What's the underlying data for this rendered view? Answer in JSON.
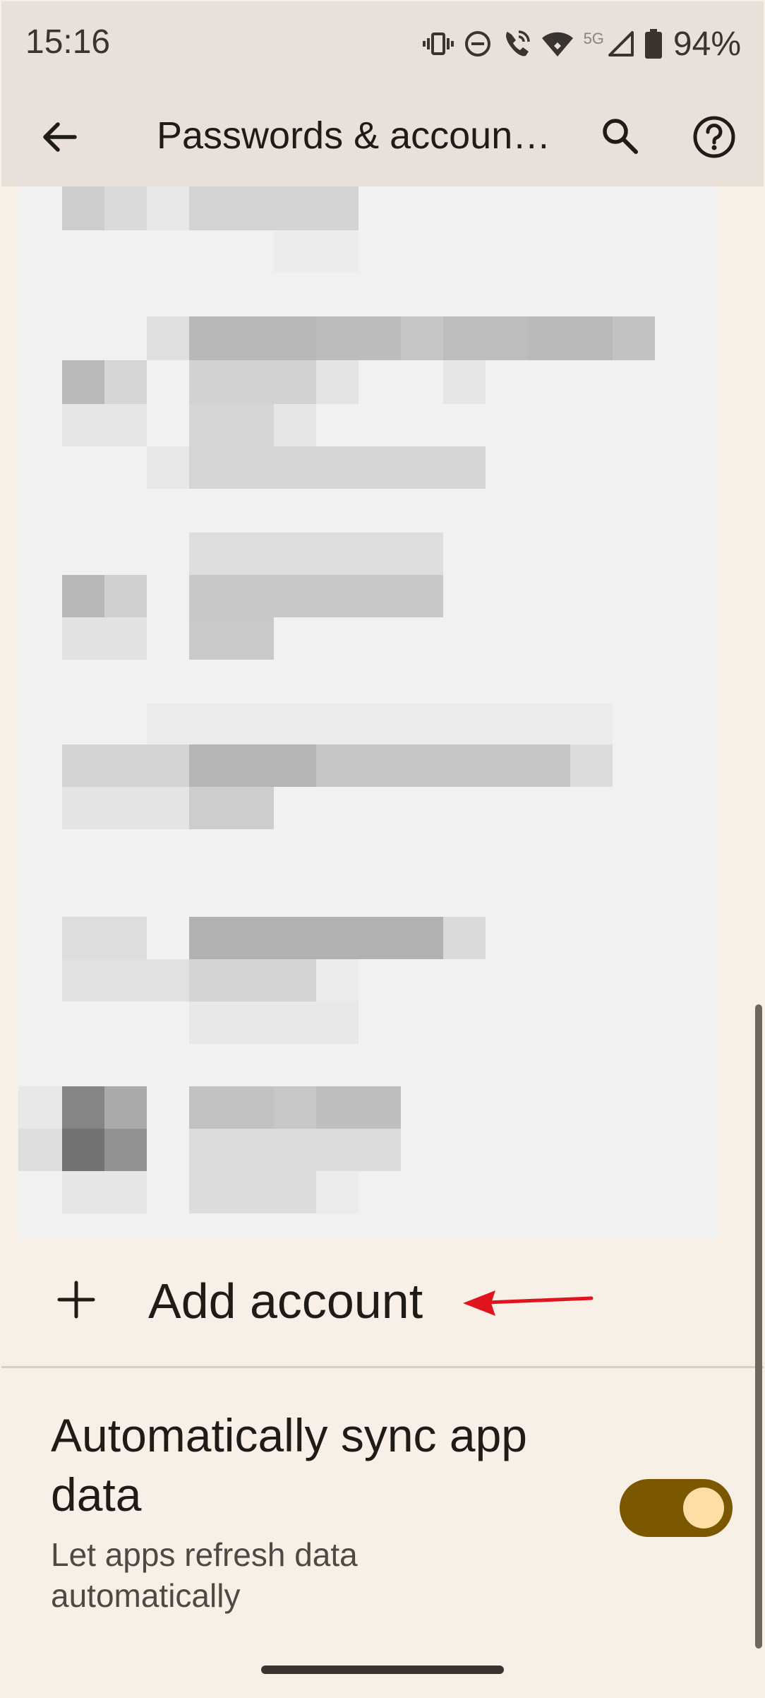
{
  "status_bar": {
    "time": "15:16",
    "network_label": "5G",
    "battery_percent": "94%",
    "icons": [
      "vibrate-icon",
      "do-not-disturb-icon",
      "wifi-calling-icon",
      "wifi-icon",
      "cell-signal-icon",
      "battery-icon"
    ]
  },
  "app_bar": {
    "title": "Passwords & accoun…",
    "icons": [
      "back-arrow-icon",
      "search-icon",
      "help-icon"
    ]
  },
  "accounts": {
    "redacted": true
  },
  "add_account": {
    "label": "Add account",
    "icon": "plus-icon",
    "annotation": "red-arrow-icon"
  },
  "sync": {
    "title": "Automatically sync app data",
    "subtitle": "Let apps refresh data automatically",
    "enabled": true
  },
  "colors": {
    "background": "#f8efe6",
    "app_bar": "#eae0da",
    "toggle_track": "#7b5800",
    "toggle_thumb": "#ffdea6",
    "annotation_arrow": "#e0141e"
  }
}
